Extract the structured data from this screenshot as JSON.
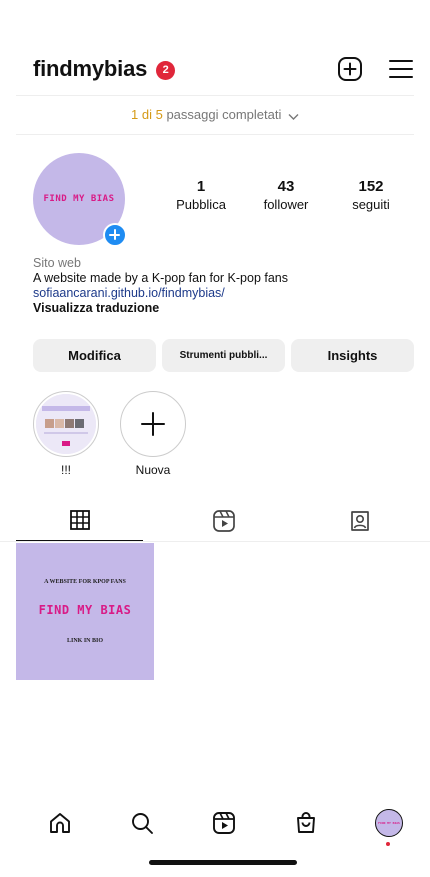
{
  "header": {
    "username": "findmybias",
    "notification_count": "2"
  },
  "steps": {
    "count": "1 di 5",
    "label": " passaggi completati"
  },
  "profile": {
    "avatar_text": "FIND MY BIAS",
    "stats": [
      {
        "value": "1",
        "label": "Pubblica"
      },
      {
        "value": "43",
        "label": "follower"
      },
      {
        "value": "152",
        "label": "seguiti"
      }
    ]
  },
  "bio": {
    "category": "Sito web",
    "text": "A website made by a K-pop fan for K-pop fans",
    "link": "sofiaancarani.github.io/findmybias/",
    "translate": "Visualizza traduzione"
  },
  "buttons": {
    "edit": "Modifica",
    "tools": "Strumenti pubbli...",
    "insights": "Insights"
  },
  "highlights": [
    {
      "label": "!!!"
    },
    {
      "label": "Nuova"
    }
  ],
  "post": {
    "line1": "A WEBSITE FOR KPOP FANS",
    "line2": "FIND MY BIAS",
    "line3": "LINK IN BIO"
  },
  "nav_avatar_text": "FIND MY BIAS",
  "colors": {
    "accent": "#c4b8e8",
    "brand_pink": "#d91a86",
    "badge_red": "#e0263a",
    "link_blue": "#1d3a8a",
    "plus_blue": "#1f8cf2"
  },
  "icons": {
    "header": [
      "add-post-icon",
      "menu-icon"
    ],
    "tabs": [
      "grid-icon",
      "reels-icon",
      "tagged-icon"
    ],
    "nav": [
      "home-icon",
      "search-icon",
      "reels-icon",
      "shop-icon",
      "profile-avatar"
    ]
  }
}
